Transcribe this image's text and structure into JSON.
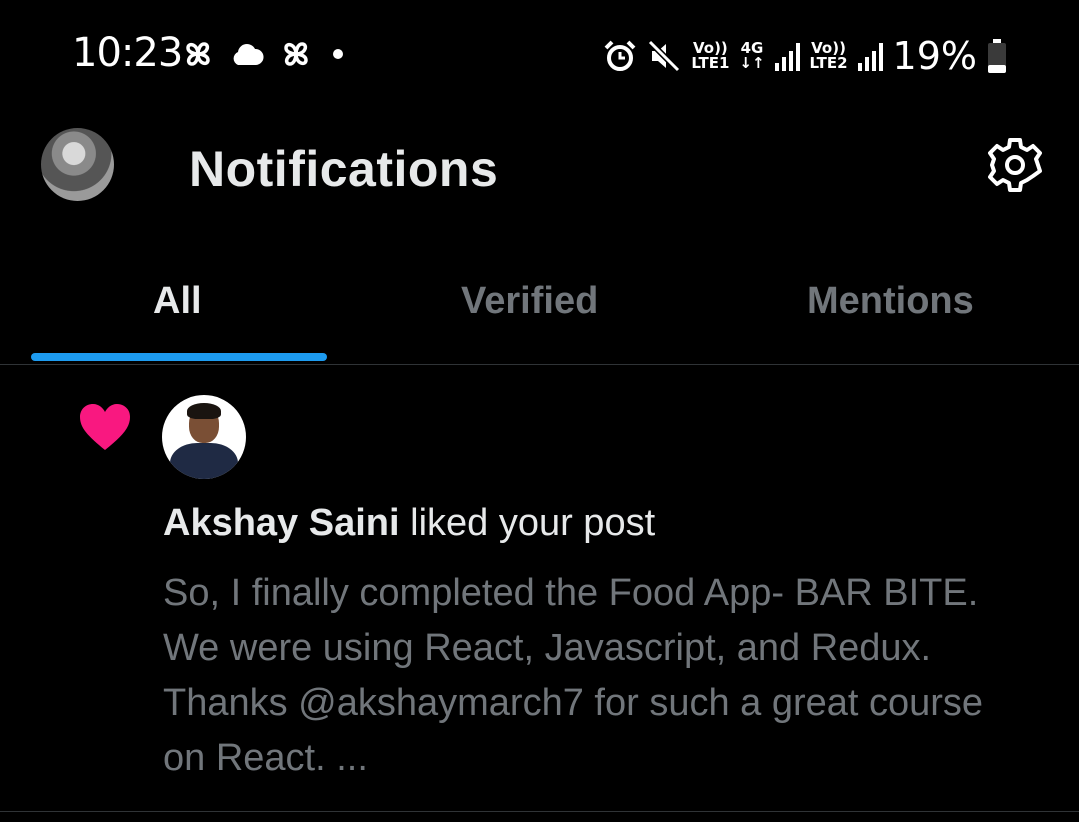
{
  "status_bar": {
    "time": "10:23",
    "left_icons": [
      "pinwheel-icon",
      "cloud-icon",
      "pinwheel-icon",
      "dot-icon"
    ],
    "sim1_label_top": "Vo))",
    "sim1_label_bottom": "LTE1",
    "net_label_top": "4G",
    "net_label_bottom": "↓↑",
    "sim2_label_top": "Vo))",
    "sim2_label_bottom": "LTE2",
    "battery": "19%"
  },
  "header": {
    "title": "Notifications"
  },
  "tabs": [
    {
      "label": "All",
      "active": true
    },
    {
      "label": "Verified",
      "active": false
    },
    {
      "label": "Mentions",
      "active": false
    }
  ],
  "notification": {
    "type_icon": "heart-icon",
    "user_name": "Akshay Saini",
    "action": " liked your post",
    "post_text": "So, I finally completed the Food App- BAR BITE. We were using React, Javascript, and Redux. Thanks @akshaymarch7 for such a great course on React. ..."
  },
  "colors": {
    "background": "#000000",
    "accent": "#1d9bf0",
    "like": "#f91880",
    "muted_text": "#71767b",
    "primary_text": "#e7e9ea",
    "divider": "#2f3336"
  }
}
